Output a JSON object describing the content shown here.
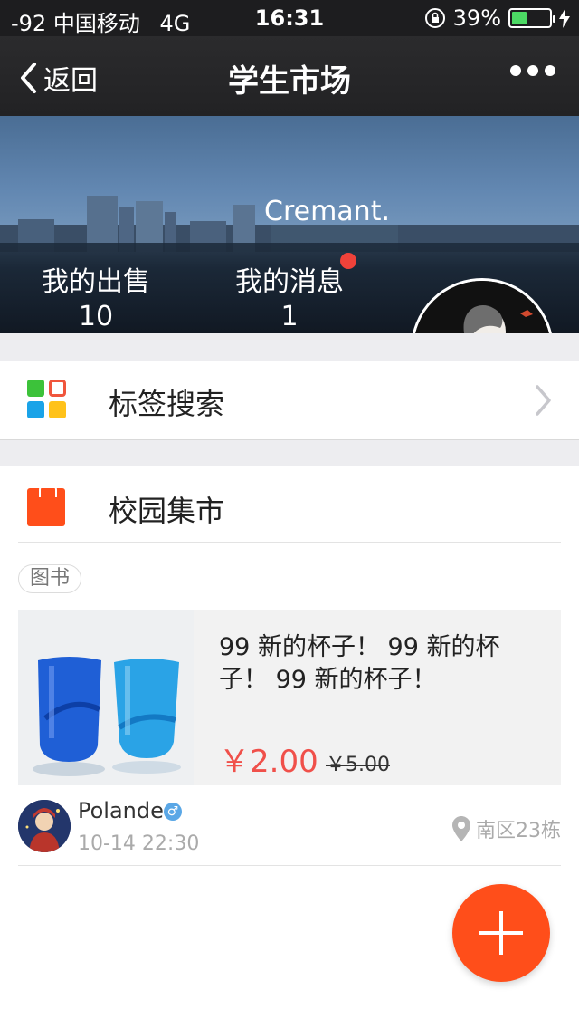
{
  "status_bar": {
    "carrier": "-92 中国移动",
    "network": "4G",
    "time": "16:31",
    "battery": "39%",
    "battery_level": 0.39,
    "lock_icon": "rotation-lock-icon",
    "charging_icon": "charging-bolt-icon"
  },
  "nav": {
    "back_label": "返回",
    "title": "学生市场",
    "more_icon": "more-dots-icon"
  },
  "profile": {
    "username": "Cremant.",
    "sales_label": "我的出售",
    "sales_count": "10",
    "messages_label": "我的消息",
    "messages_count": "1",
    "unread_dot_color": "#f0423a"
  },
  "tag_search": {
    "label": "标签搜索",
    "icon": "colored-grid-icon"
  },
  "market": {
    "label": "校园集市",
    "icon": "shopping-bag-icon",
    "accent_color": "#ff4e1a"
  },
  "listing": {
    "category": "图书",
    "title": "99 新的杯子！ 99 新的杯子！ 99 新的杯子！",
    "price": "￥2.00",
    "original_price": "￥5.00",
    "seller": "Polande",
    "seller_gender_icon": "male-icon",
    "posted_at": "10-14 22:30",
    "location": "南区23栋",
    "location_icon": "location-pin-icon"
  },
  "fab": {
    "icon": "plus-icon"
  }
}
